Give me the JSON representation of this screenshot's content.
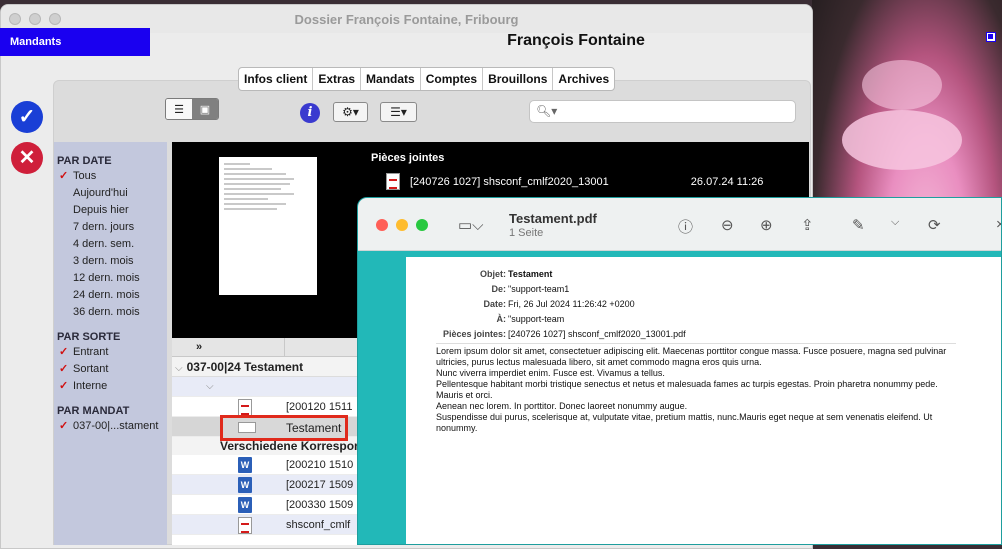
{
  "window": {
    "title": "Dossier François Fontaine, Fribourg"
  },
  "header": {
    "mandants_tab": "Mandants",
    "client_name": "François Fontaine"
  },
  "tabs": [
    "Infos client",
    "Extras",
    "Mandats",
    "Comptes",
    "Brouillons",
    "Archives"
  ],
  "filters": {
    "par_date": {
      "title": "PAR DATE",
      "items": [
        {
          "label": "Tous",
          "checked": true
        },
        {
          "label": "Aujourd'hui"
        },
        {
          "label": "Depuis hier"
        },
        {
          "label": "7 dern. jours"
        },
        {
          "label": "4 dern. sem."
        },
        {
          "label": "3 dern. mois"
        },
        {
          "label": "12 dern. mois"
        },
        {
          "label": "24 dern. mois"
        },
        {
          "label": "36 dern. mois"
        }
      ]
    },
    "par_sorte": {
      "title": "PAR SORTE",
      "items": [
        {
          "label": "Entrant",
          "checked": true
        },
        {
          "label": "Sortant",
          "checked": true
        },
        {
          "label": "Interne",
          "checked": true
        }
      ]
    },
    "par_mandat": {
      "title": "PAR MANDAT",
      "items": [
        {
          "label": "037-00|...stament",
          "checked": true
        }
      ]
    }
  },
  "attachments": {
    "title": "Pièces jointes",
    "file": "[240726 1027] shsconf_cmlf2020_13001",
    "date": "26.07.24 11:26"
  },
  "list": {
    "header_symbol": "»",
    "group": "037-00|24 Testament",
    "rows": [
      {
        "text": "[200120 1511",
        "icon": "pdf-icon"
      },
      {
        "text": "Testament",
        "icon": "mail-icon"
      }
    ],
    "subgroup": "Verschiedene Korrespon",
    "rows2": [
      {
        "text": "[200210 1510",
        "icon": "word-icon"
      },
      {
        "text": "[200217 1509",
        "icon": "word-icon"
      },
      {
        "text": "[200330 1509",
        "icon": "word-icon"
      },
      {
        "text": "shsconf_cmlf",
        "icon": "pdf-icon"
      }
    ]
  },
  "preview": {
    "title": "Testament.pdf",
    "subtitle": "1 Seite",
    "meta": [
      {
        "k": "Objet:",
        "v": "Testament"
      },
      {
        "k": "De:",
        "v": "\"support-team1"
      },
      {
        "k": "Date:",
        "v": "Fri, 26 Jul 2024 11:26:42 +0200"
      },
      {
        "k": "À:",
        "v": "\"support-team"
      },
      {
        "k": "Pièces jointes:",
        "v": "[240726 1027] shsconf_cmlf2020_13001.pdf"
      }
    ],
    "body": [
      "Lorem ipsum dolor sit amet, consectetuer adipiscing elit. Maecenas porttitor congue massa. Fusce posuere, magna sed pulvinar ultricies, purus lectus malesuada libero, sit amet commodo magna eros quis urna.",
      "Nunc viverra imperdiet enim. Fusce est. Vivamus a tellus.",
      "Pellentesque habitant morbi tristique senectus et netus et malesuada fames ac turpis egestas. Proin pharetra nonummy pede. Mauris et orci.",
      "Aenean nec lorem. In porttitor. Donec laoreet nonummy augue.",
      "Suspendisse dui purus, scelerisque at, vulputate vitae, pretium mattis, nunc.Mauris eget neque at sem venenatis eleifend. Ut nonummy."
    ]
  },
  "colors": {
    "accent_blue": "#1a00f0",
    "confirm": "#1a3fd6",
    "cancel": "#cf1f3a",
    "preview_bg": "#22b8b8",
    "highlight": "#e02a1c"
  }
}
